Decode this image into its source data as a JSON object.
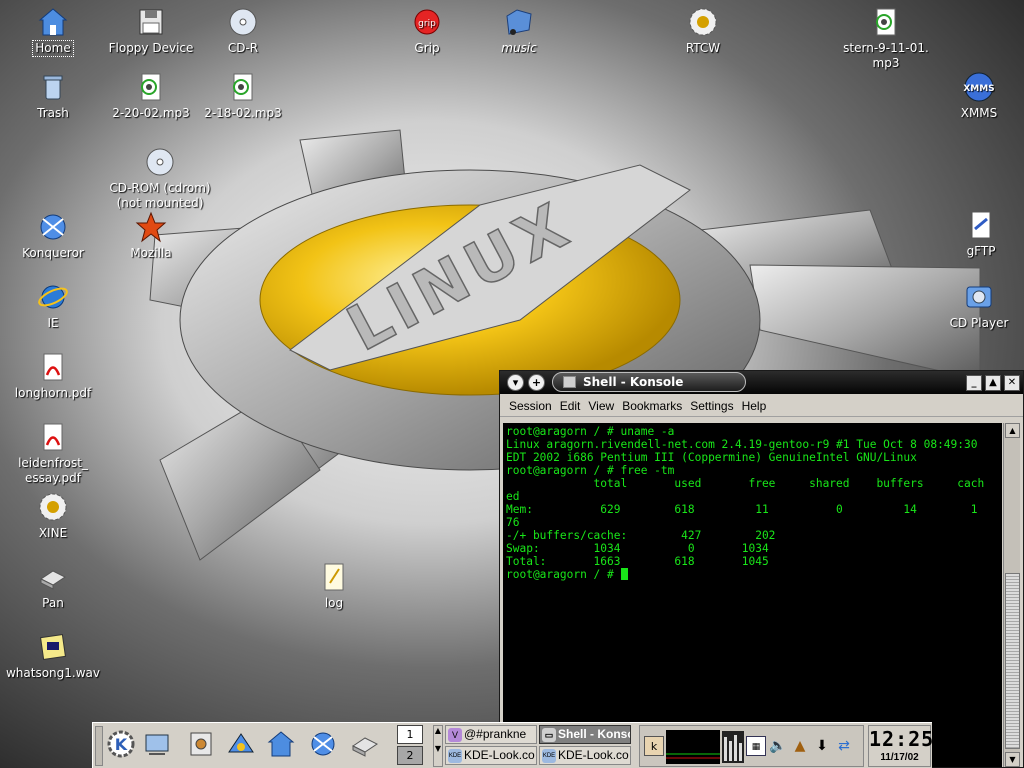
{
  "desktop": {
    "wallpaper": {
      "accent": "#f2c316",
      "emblem_text": "LINUX"
    },
    "icons": [
      {
        "label": "Home",
        "icon": "home-icon"
      },
      {
        "label": "Floppy Device",
        "icon": "floppy-icon"
      },
      {
        "label": "CD-R",
        "icon": "cdr-icon"
      },
      {
        "label": "Grip",
        "icon": "grip-icon"
      },
      {
        "label": "music",
        "icon": "folder-music-icon"
      },
      {
        "label": "RTCW",
        "icon": "rtcw-icon"
      },
      {
        "label": "stern-9-11-01.\nmp3",
        "icon": "audio-file-icon"
      },
      {
        "label": "Trash",
        "icon": "trash-icon"
      },
      {
        "label": "2-20-02.mp3",
        "icon": "audio-file-icon"
      },
      {
        "label": "2-18-02.mp3",
        "icon": "audio-file-icon"
      },
      {
        "label": "XMMS",
        "icon": "xmms-icon"
      },
      {
        "label": "CD-ROM (cdrom)\n(not mounted)",
        "icon": "cdrom-icon"
      },
      {
        "label": "Konqueror",
        "icon": "konqueror-icon"
      },
      {
        "label": "Mozilla",
        "icon": "mozilla-icon"
      },
      {
        "label": "gFTP",
        "icon": "gftp-icon"
      },
      {
        "label": "IE",
        "icon": "ie-icon"
      },
      {
        "label": "CD Player",
        "icon": "cd-player-icon"
      },
      {
        "label": "longhorn.pdf",
        "icon": "pdf-icon"
      },
      {
        "label": "leidenfrost_\nessay.pdf",
        "icon": "pdf-icon"
      },
      {
        "label": "XINE",
        "icon": "xine-icon"
      },
      {
        "label": "log",
        "icon": "text-file-icon"
      },
      {
        "label": "Pan",
        "icon": "pan-icon"
      },
      {
        "label": "whatsong1.wav",
        "icon": "wav-file-icon"
      }
    ]
  },
  "konsole": {
    "title": "Shell - Konsole",
    "buttons": {
      "menu": "▾",
      "sticky": "+",
      "minimize": "_",
      "maximize": "▲",
      "close": "✕"
    },
    "menu": [
      "Session",
      "Edit",
      "View",
      "Bookmarks",
      "Settings",
      "Help"
    ],
    "lines": [
      "root@aragorn / # uname -a",
      "Linux aragorn.rivendell-net.com 2.4.19-gentoo-r9 #1 Tue Oct 8 08:49:30",
      "EDT 2002 i686 Pentium III (Coppermine) GenuineIntel GNU/Linux",
      "root@aragorn / # free -tm",
      "             total       used       free     shared    buffers     cach",
      "ed",
      "Mem:          629        618         11          0         14        1",
      "76",
      "-/+ buffers/cache:        427        202",
      "Swap:        1034          0       1034",
      "Total:       1663        618       1045"
    ],
    "prompt": "root@aragorn / # "
  },
  "taskbar": {
    "pager": [
      "1",
      "2"
    ],
    "tasks": [
      "@#prankne",
      "Shell - Konso",
      "KDE-Look.co",
      "KDE-Look.co"
    ],
    "clock": {
      "time": "12:25",
      "date": "11/17/02"
    }
  }
}
